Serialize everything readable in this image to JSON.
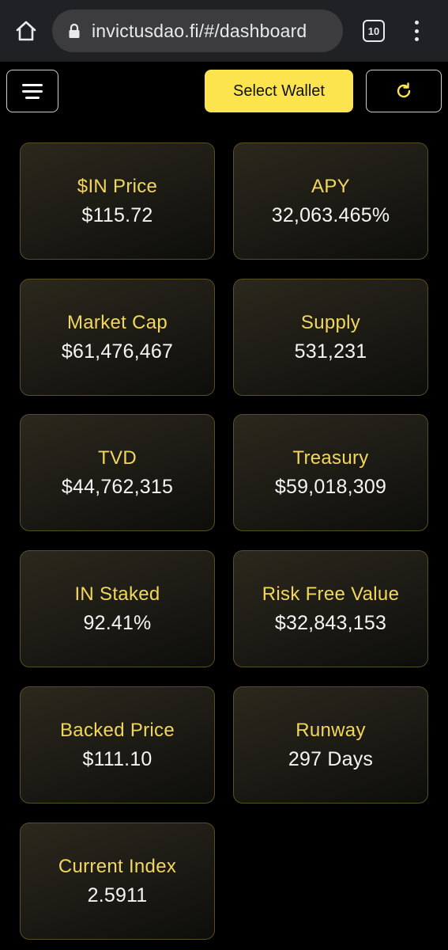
{
  "browser": {
    "url": "invictusdao.fi/#/dashboard",
    "tab_count": "10"
  },
  "header": {
    "wallet_label": "Select Wallet"
  },
  "stats": [
    {
      "label": "$IN Price",
      "value": "$115.72"
    },
    {
      "label": "APY",
      "value": "32,063.465%"
    },
    {
      "label": "Market Cap",
      "value": "$61,476,467"
    },
    {
      "label": "Supply",
      "value": "531,231"
    },
    {
      "label": "TVD",
      "value": "$44,762,315"
    },
    {
      "label": "Treasury",
      "value": "$59,018,309"
    },
    {
      "label": "IN Staked",
      "value": "92.41%"
    },
    {
      "label": "Risk Free Value",
      "value": "$32,843,153"
    },
    {
      "label": "Backed Price",
      "value": "$111.10"
    },
    {
      "label": "Runway",
      "value": "297 Days"
    },
    {
      "label": "Current Index",
      "value": "2.5911"
    }
  ],
  "colors": {
    "accent": "#fbe44d",
    "label": "#f3d75a",
    "card_border": "#5a4e22",
    "background": "#000000"
  },
  "icons": [
    "home-icon",
    "lock-icon",
    "tabs-icon",
    "more-vert-icon",
    "hamburger-icon",
    "refresh-icon"
  ]
}
